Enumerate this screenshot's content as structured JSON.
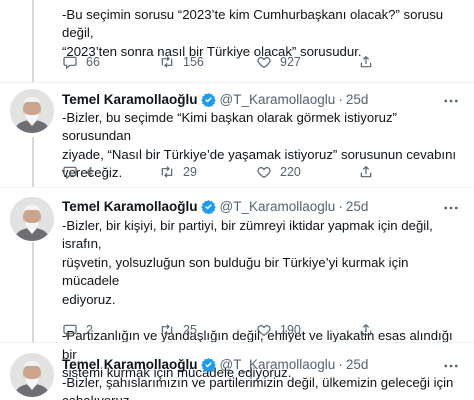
{
  "tweets": [
    {
      "text": "-Bu seçimin sorusu “2023’te kim Cumhurbaşkanı olacak?” sorusu değil,\n“2023’ten sonra nasıl bir Türkiye olacak” sorusudur.",
      "replies": "66",
      "retweets": "156",
      "likes": "927"
    },
    {
      "name": "Temel Karamollaoğlu",
      "handle": "@T_Karamollaoglu",
      "separator": "·",
      "time": "25d",
      "text": "-Bizler, bu seçimde “Kimi başkan olarak görmek istiyoruz” sorusundan\nziyade, “Nasıl bir Türkiye’de yaşamak istiyoruz” sorusunun cevabını\nvereceğiz.",
      "replies": "4",
      "retweets": "29",
      "likes": "220"
    },
    {
      "name": "Temel Karamollaoğlu",
      "handle": "@T_Karamollaoglu",
      "separator": "·",
      "time": "25d",
      "text": "-Bizler, bir kişiyi, bir partiyi, bir zümreyi iktidar yapmak için değil, israfın,\nrüşvetin, yolsuzluğun son bulduğu bir Türkiye’yi kurmak için mücadele\nediyoruz.\n\n-Partizanlığın ve yandaşlığın değil, ehliyet ve liyakatin esas alındığı bir\nsistemi kurmak için mücadele ediyoruz.",
      "replies": "2",
      "retweets": "25",
      "likes": "190"
    },
    {
      "name": "Temel Karamollaoğlu",
      "handle": "@T_Karamollaoglu",
      "separator": "·",
      "time": "25d",
      "text": "-Bizler, şahıslarımızın ve partilerimizin değil, ülkemizin geleceği için\ncabalıyoruz."
    }
  ],
  "icons": {
    "reply": "reply-icon",
    "retweet": "retweet-icon",
    "like": "heart-icon",
    "share": "share-icon",
    "verified": "verified-badge-icon",
    "more": "more-icon"
  },
  "colors": {
    "text": "#0f1419",
    "muted": "#536471",
    "verified": "#1d9bf0",
    "thread_line": "#cfd9de",
    "divider": "#eff3f4"
  }
}
